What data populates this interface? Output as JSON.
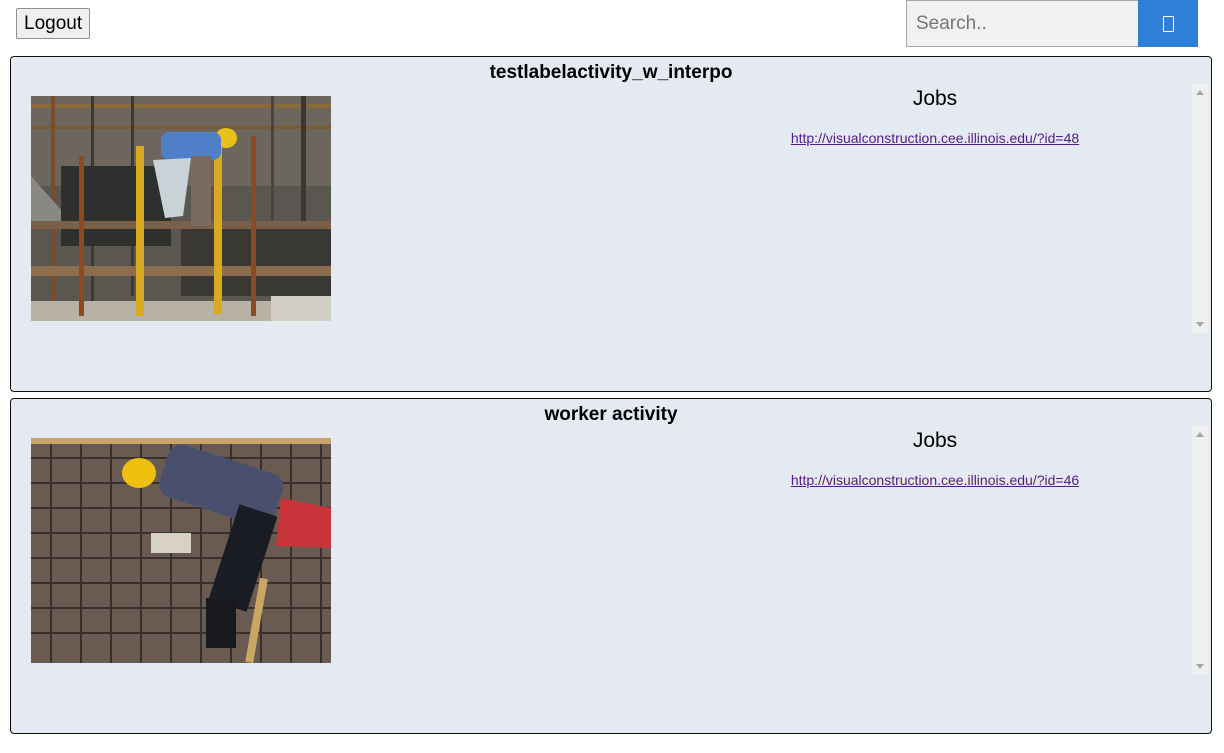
{
  "header": {
    "logout_label": "Logout",
    "search_placeholder": "Search..",
    "search_icon": "search-icon"
  },
  "cards": [
    {
      "title": "testlabelactivity_w_interpo",
      "jobs_heading": "Jobs",
      "job_link": "http://visualconstruction.cee.illinois.edu/?id=48"
    },
    {
      "title": "worker activity",
      "jobs_heading": "Jobs",
      "job_link": "http://visualconstruction.cee.illinois.edu/?id=46"
    }
  ],
  "colors": {
    "card_background": "#e5e9f2",
    "search_button": "#2f7ed8",
    "link": "#551a8b"
  }
}
